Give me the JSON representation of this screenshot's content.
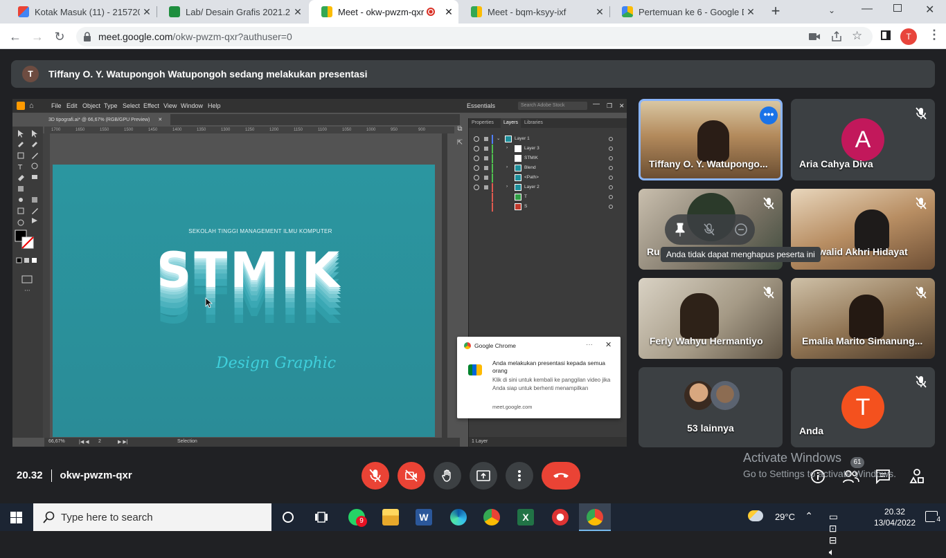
{
  "browser": {
    "tabs": [
      {
        "title": "Kotak Masuk (11) - 2157200",
        "icon": "gmail-icon",
        "active": false
      },
      {
        "title": "Lab/ Desain Grafis 2021.2 / R",
        "icon": "classroom-icon",
        "active": false
      },
      {
        "title": "Meet - okw-pwzm-qxr",
        "icon": "meet-icon",
        "active": true
      },
      {
        "title": "Meet - bqm-ksyy-ixf",
        "icon": "meet-icon",
        "active": false
      },
      {
        "title": "Pertemuan ke 6 - Google Dri",
        "icon": "drive-icon",
        "active": false
      }
    ],
    "url_host": "meet.google.com",
    "url_path": "/okw-pwzm-qxr?authuser=0",
    "profile_initial": "T"
  },
  "meet": {
    "presenter_initial": "T",
    "presenting_banner": "Tiffany O. Y. Watupongoh Watupongoh sedang melakukan presentasi",
    "participants": [
      {
        "name": "Tiffany O. Y. Watupongo...",
        "type": "video"
      },
      {
        "name": "Aria Cahya Diva",
        "type": "avatar",
        "initial": "A",
        "color": "#c2185b"
      },
      {
        "name": "Ru",
        "type": "video"
      },
      {
        "name": "walid Akhri Hidayat",
        "type": "video"
      },
      {
        "name": "Ferly Wahyu Hermantiyo",
        "type": "video"
      },
      {
        "name": "Emalia Marito Simanung...",
        "type": "video"
      },
      {
        "name": "53 lainnya",
        "type": "group"
      },
      {
        "name": "Anda",
        "type": "avatar",
        "initial": "T",
        "color": "#f4511e"
      }
    ],
    "tooltip": "Anda tidak dapat menghapus peserta ini",
    "time": "20.32",
    "meeting_code": "okw-pwzm-qxr",
    "people_count": "61",
    "activate_line1": "Activate Windows",
    "activate_line2": "Go to Settings to activate Windows."
  },
  "illustrator": {
    "menu": [
      "File",
      "Edit",
      "Object",
      "Type",
      "Select",
      "Effect",
      "View",
      "Window",
      "Help"
    ],
    "workspace": "Essentials",
    "search_placeholder": "Search Adobe Stock",
    "doc_tab": "3D tipografi.ai* @ 66,67% (RGB/GPU Preview)",
    "ruler_ticks": [
      "1700",
      "1650",
      "1550",
      "1500",
      "1450",
      "1400",
      "1350",
      "1300",
      "1250",
      "1200",
      "1150",
      "1100",
      "1050",
      "1000",
      "950",
      "900"
    ],
    "art_subtitle": "SEKOLAH TINGGI MANAGEMENT ILMU KOMPUTER",
    "art_title": "STMIK",
    "art_script": "Design Graphic",
    "panel_tabs": [
      "Properties",
      "Layers",
      "Libraries"
    ],
    "layers": [
      {
        "name": "Layer 1",
        "indent": 0
      },
      {
        "name": "Layer 3",
        "indent": 1
      },
      {
        "name": "STMIK",
        "indent": 1
      },
      {
        "name": "Blend",
        "indent": 1
      },
      {
        "name": "<Path>",
        "indent": 1
      },
      {
        "name": "Layer 2",
        "indent": 1
      },
      {
        "name": "T",
        "indent": 1
      },
      {
        "name": "S",
        "indent": 1
      }
    ],
    "layer_count": "1 Layer",
    "zoom": "66,67%",
    "page": "2",
    "status_tool": "Selection"
  },
  "notification": {
    "app": "Google Chrome",
    "title": "Anda melakukan presentasi kepada semua orang",
    "body": "Klik di sini untuk kembali ke panggilan video jika Anda siap untuk berhenti menampilkan",
    "domain": "meet.google.com"
  },
  "taskbar": {
    "search_placeholder": "Type here to search",
    "whatsapp_badge": "9",
    "weather": "29°C",
    "time": "20.32",
    "date": "13/04/2022",
    "notif_count": "4"
  },
  "colors": {
    "meet_bg": "#202124",
    "tile_bg": "#3c4043",
    "end_call": "#ea4335",
    "artboard": "#2b96a0"
  }
}
